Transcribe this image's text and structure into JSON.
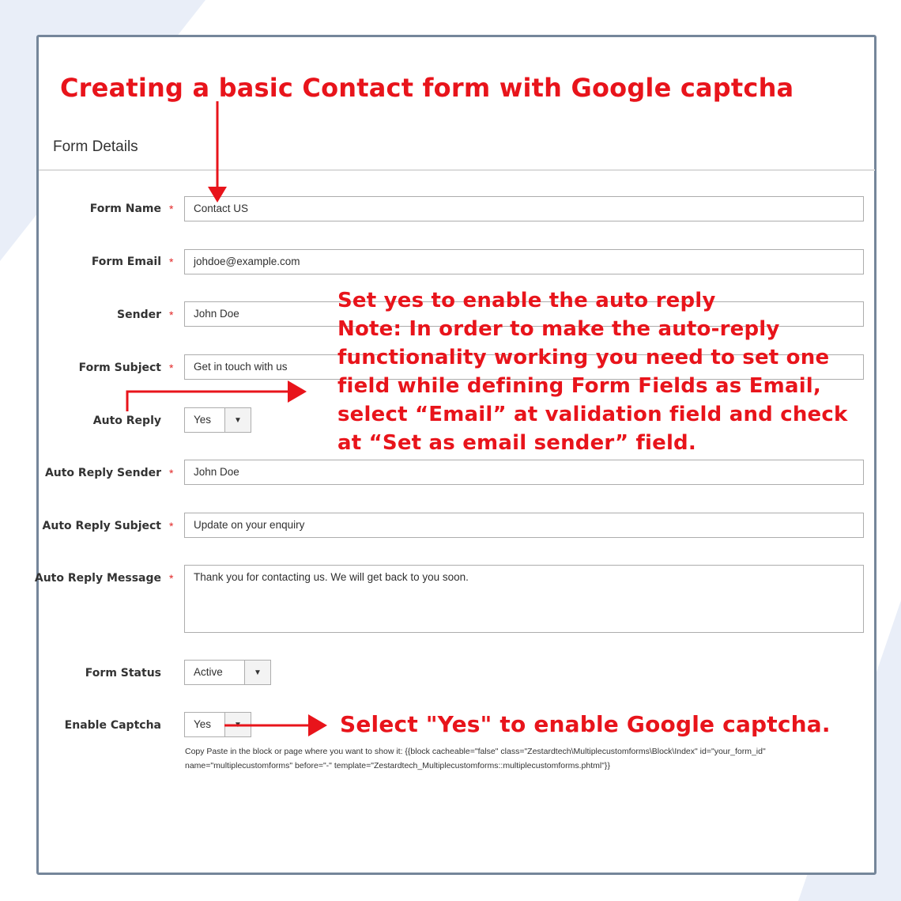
{
  "heading": "Creating a basic Contact form with Google captcha",
  "section_title": "Form Details",
  "fields": {
    "form_name": {
      "label": "Form Name",
      "value": "Contact US",
      "required": "*"
    },
    "form_email": {
      "label": "Form Email",
      "value": "johdoe@example.com",
      "required": "*"
    },
    "sender": {
      "label": "Sender",
      "value": "John Doe",
      "required": "*"
    },
    "form_subject": {
      "label": "Form Subject",
      "value": "Get in touch with us",
      "required": "*"
    },
    "auto_reply": {
      "label": "Auto Reply",
      "value": "Yes"
    },
    "auto_reply_sender": {
      "label": "Auto Reply Sender",
      "value": "John  Doe",
      "required": "*"
    },
    "auto_reply_subject": {
      "label": "Auto Reply Subject",
      "value": "Update on your enquiry",
      "required": "*"
    },
    "auto_reply_message": {
      "label": "Auto Reply Message",
      "value": "Thank you for contacting us. We will get back to you soon.",
      "required": "*"
    },
    "form_status": {
      "label": "Form Status",
      "value": "Active"
    },
    "enable_captcha": {
      "label": "Enable Captcha",
      "value": "Yes"
    }
  },
  "captcha_hint": "Copy Paste in the block or page where you want to show it: {{block cacheable=\"false\" class=\"Zestardtech\\Multiplecustomforms\\Block\\Index\" id=\"your_form_id\" name=\"multiplecustomforms\" before=\"-\" template=\"Zestardtech_Multiplecustomforms::multiplecustomforms.phtml\"}}",
  "annotations": {
    "auto_reply_note": [
      "Set yes to enable the auto reply",
      "Note: In order to make the auto-reply",
      "functionality working you need to set one",
      "field while defining Form Fields as Email,",
      "select “Email” at validation field and check",
      "at  “Set as email sender” field."
    ],
    "captcha_note": "Select \"Yes\" to enable  Google captcha."
  },
  "colors": {
    "annotation": "#e8141b",
    "border": "#75869a"
  },
  "icons": {
    "dropdown": "chevron-down-icon"
  }
}
